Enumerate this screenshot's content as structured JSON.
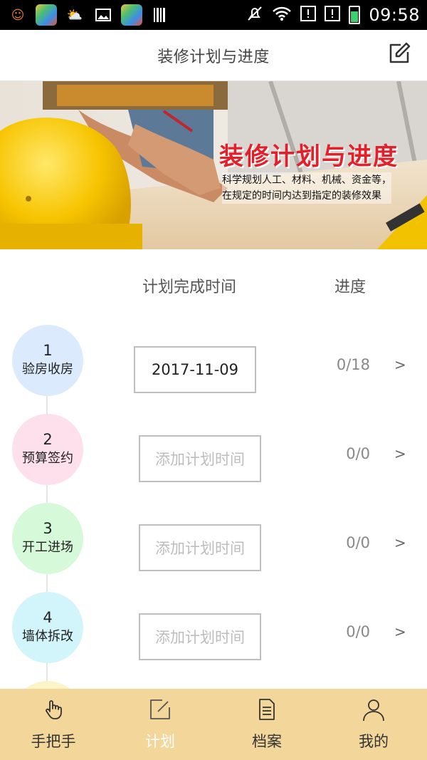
{
  "status_bar": {
    "time": "09:58",
    "colors": {
      "battery": "#3bd16f"
    }
  },
  "header": {
    "title": "装修计划与进度"
  },
  "banner": {
    "title": "装修计划与进度",
    "subtitle_line1": "科学规划人工、材料、机械、资金等，",
    "subtitle_line2": "在规定的时间内达到指定的装修效果"
  },
  "columns": {
    "plan_time": "计划完成时间",
    "progress": "进度"
  },
  "steps": [
    {
      "number": "1",
      "name": "验房收房",
      "date": "2017-11-09",
      "progress": "0/18",
      "color": "#dbeafc"
    },
    {
      "number": "2",
      "name": "预算签约",
      "date": "添加计划时间",
      "progress": "0/0",
      "color": "#fde0ec"
    },
    {
      "number": "3",
      "name": "开工进场",
      "date": "添加计划时间",
      "progress": "0/0",
      "color": "#d6fad9"
    },
    {
      "number": "4",
      "name": "墙体拆改",
      "date": "添加计划时间",
      "progress": "0/0",
      "color": "#d2f4fb"
    }
  ],
  "chevron": ">",
  "bottom_nav": {
    "items": [
      {
        "label": "手把手",
        "icon": "hand-pointer-icon"
      },
      {
        "label": "计划",
        "icon": "calendar-edit-icon"
      },
      {
        "label": "档案",
        "icon": "document-icon"
      },
      {
        "label": "我的",
        "icon": "user-icon"
      }
    ],
    "colors": {
      "background": "#f2d69a",
      "active": "#ffffff"
    }
  }
}
